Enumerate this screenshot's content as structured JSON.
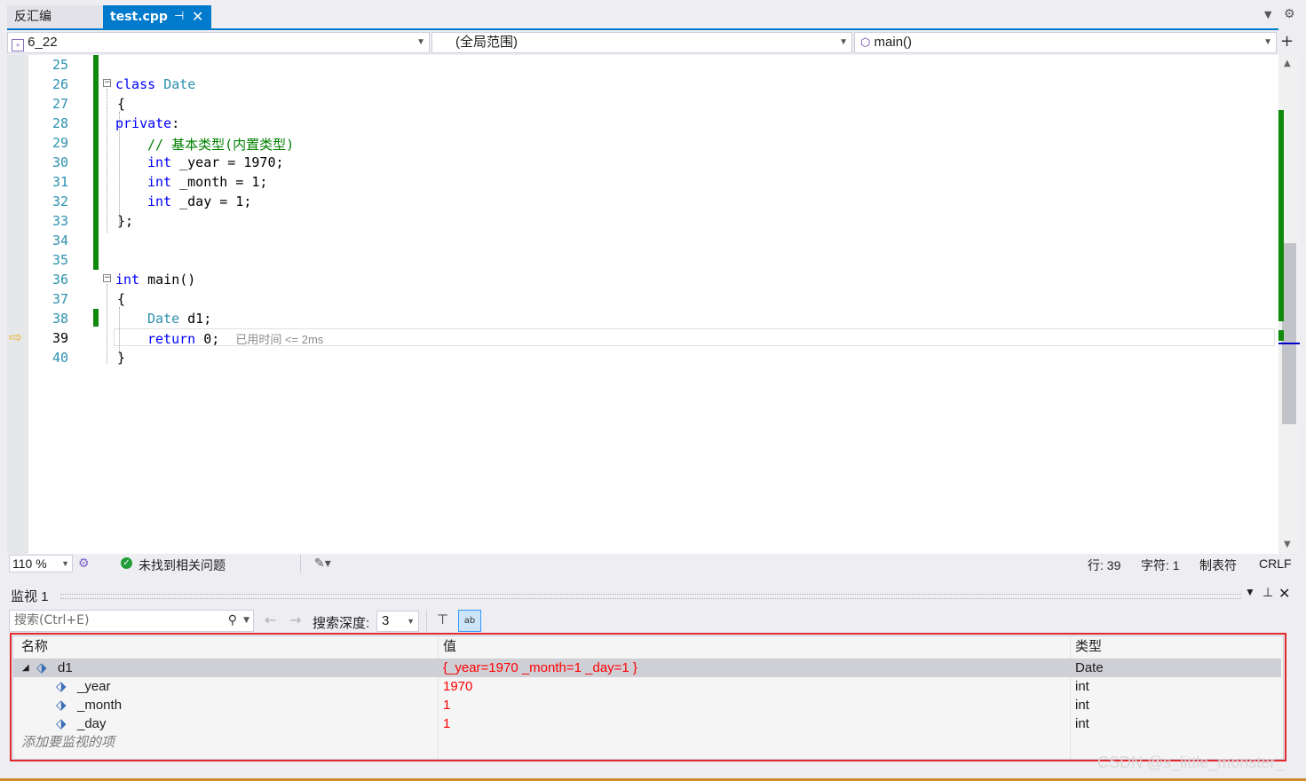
{
  "tabs": {
    "disasm_label": "反汇编",
    "active_label": "test.cpp",
    "pin_glyph": "⊣",
    "close_glyph": "✕"
  },
  "navbar": {
    "project": "6_22",
    "scope": "(全局范围)",
    "member": "main()"
  },
  "editor": {
    "line_numbers": [
      "25",
      "26",
      "27",
      "28",
      "29",
      "30",
      "31",
      "32",
      "33",
      "34",
      "35",
      "36",
      "37",
      "38",
      "39",
      "40"
    ],
    "code": {
      "l26_kw": "class",
      "l26_name": "Date",
      "l27": "{",
      "l28_kw": "private",
      "l28_rest": ":",
      "l29": "// 基本类型(内置类型)",
      "l30_kw": "int",
      "l30_rest": " _year = 1970;",
      "l31_kw": "int",
      "l31_rest": " _month = 1;",
      "l32_kw": "int",
      "l32_rest": " _day = 1;",
      "l33": "};",
      "l36_kw": "int",
      "l36_rest": " main()",
      "l37": "{",
      "l38_ty": "Date",
      "l38_rest": " d1;",
      "l39_kw": "return",
      "l39_rest": " 0;",
      "l39_hint": "已用时间 <= 2ms",
      "l40": "}"
    }
  },
  "editor_status": {
    "zoom": "110 %",
    "issues": "未找到相关问题",
    "line": "行: 39",
    "char": "字符: 1",
    "tabs": "制表符",
    "eol": "CRLF"
  },
  "watch": {
    "title": "监视 1",
    "search_placeholder": "搜索(Ctrl+E)",
    "depth_label": "搜索深度:",
    "depth_value": "3",
    "columns": [
      "名称",
      "值",
      "类型"
    ],
    "rows": [
      {
        "name": "d1",
        "value": "{_year=1970 _month=1 _day=1 }",
        "type": "Date"
      },
      {
        "name": "_year",
        "value": "1970",
        "type": "int"
      },
      {
        "name": "_month",
        "value": "1",
        "type": "int"
      },
      {
        "name": "_day",
        "value": "1",
        "type": "int"
      }
    ],
    "add_item": "添加要监视的项"
  },
  "watermark": "CSDN @s_little_monster_",
  "colors": {
    "accent": "#007acc",
    "change_bar": "#108a0c",
    "keyword": "#0000ff",
    "type": "#2b91af",
    "comment": "#008000",
    "changed_value": "#ff0000",
    "highlight_frame": "#e0282d"
  }
}
